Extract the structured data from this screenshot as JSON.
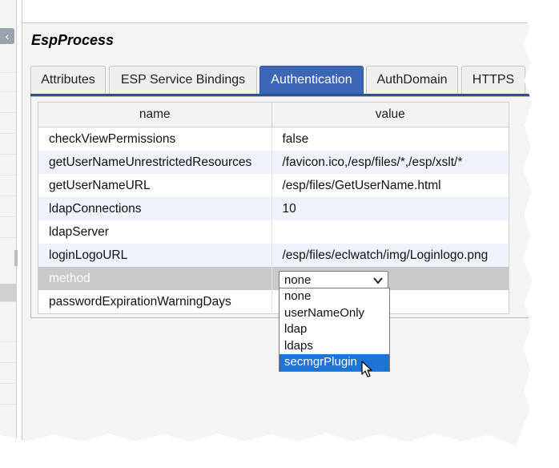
{
  "panel": {
    "title": "EspProcess"
  },
  "tabs": [
    "Attributes",
    "ESP Service Bindings",
    "Authentication",
    "AuthDomain",
    "HTTPS"
  ],
  "table": {
    "headers": {
      "name": "name",
      "value": "value"
    },
    "rows": [
      {
        "name": "checkViewPermissions",
        "value": "false"
      },
      {
        "name": "getUserNameUnrestrictedResources",
        "value": "/favicon.ico,/esp/files/*,/esp/xslt/*"
      },
      {
        "name": "getUserNameURL",
        "value": "/esp/files/GetUserName.html"
      },
      {
        "name": "ldapConnections",
        "value": "10"
      },
      {
        "name": "ldapServer",
        "value": ""
      },
      {
        "name": "loginLogoURL",
        "value": "/esp/files/eclwatch/img/Loginlogo.png"
      },
      {
        "name": "method",
        "value": ""
      },
      {
        "name": "passwordExpirationWarningDays",
        "value": ""
      }
    ]
  },
  "method_select": {
    "selected": "none",
    "options": [
      "none",
      "userNameOnly",
      "ldap",
      "ldaps",
      "secmgrPlugin"
    ],
    "highlighted": "secmgrPlugin"
  },
  "colors": {
    "active_tab": "#3b66b5",
    "highlight": "#1e73d6"
  }
}
